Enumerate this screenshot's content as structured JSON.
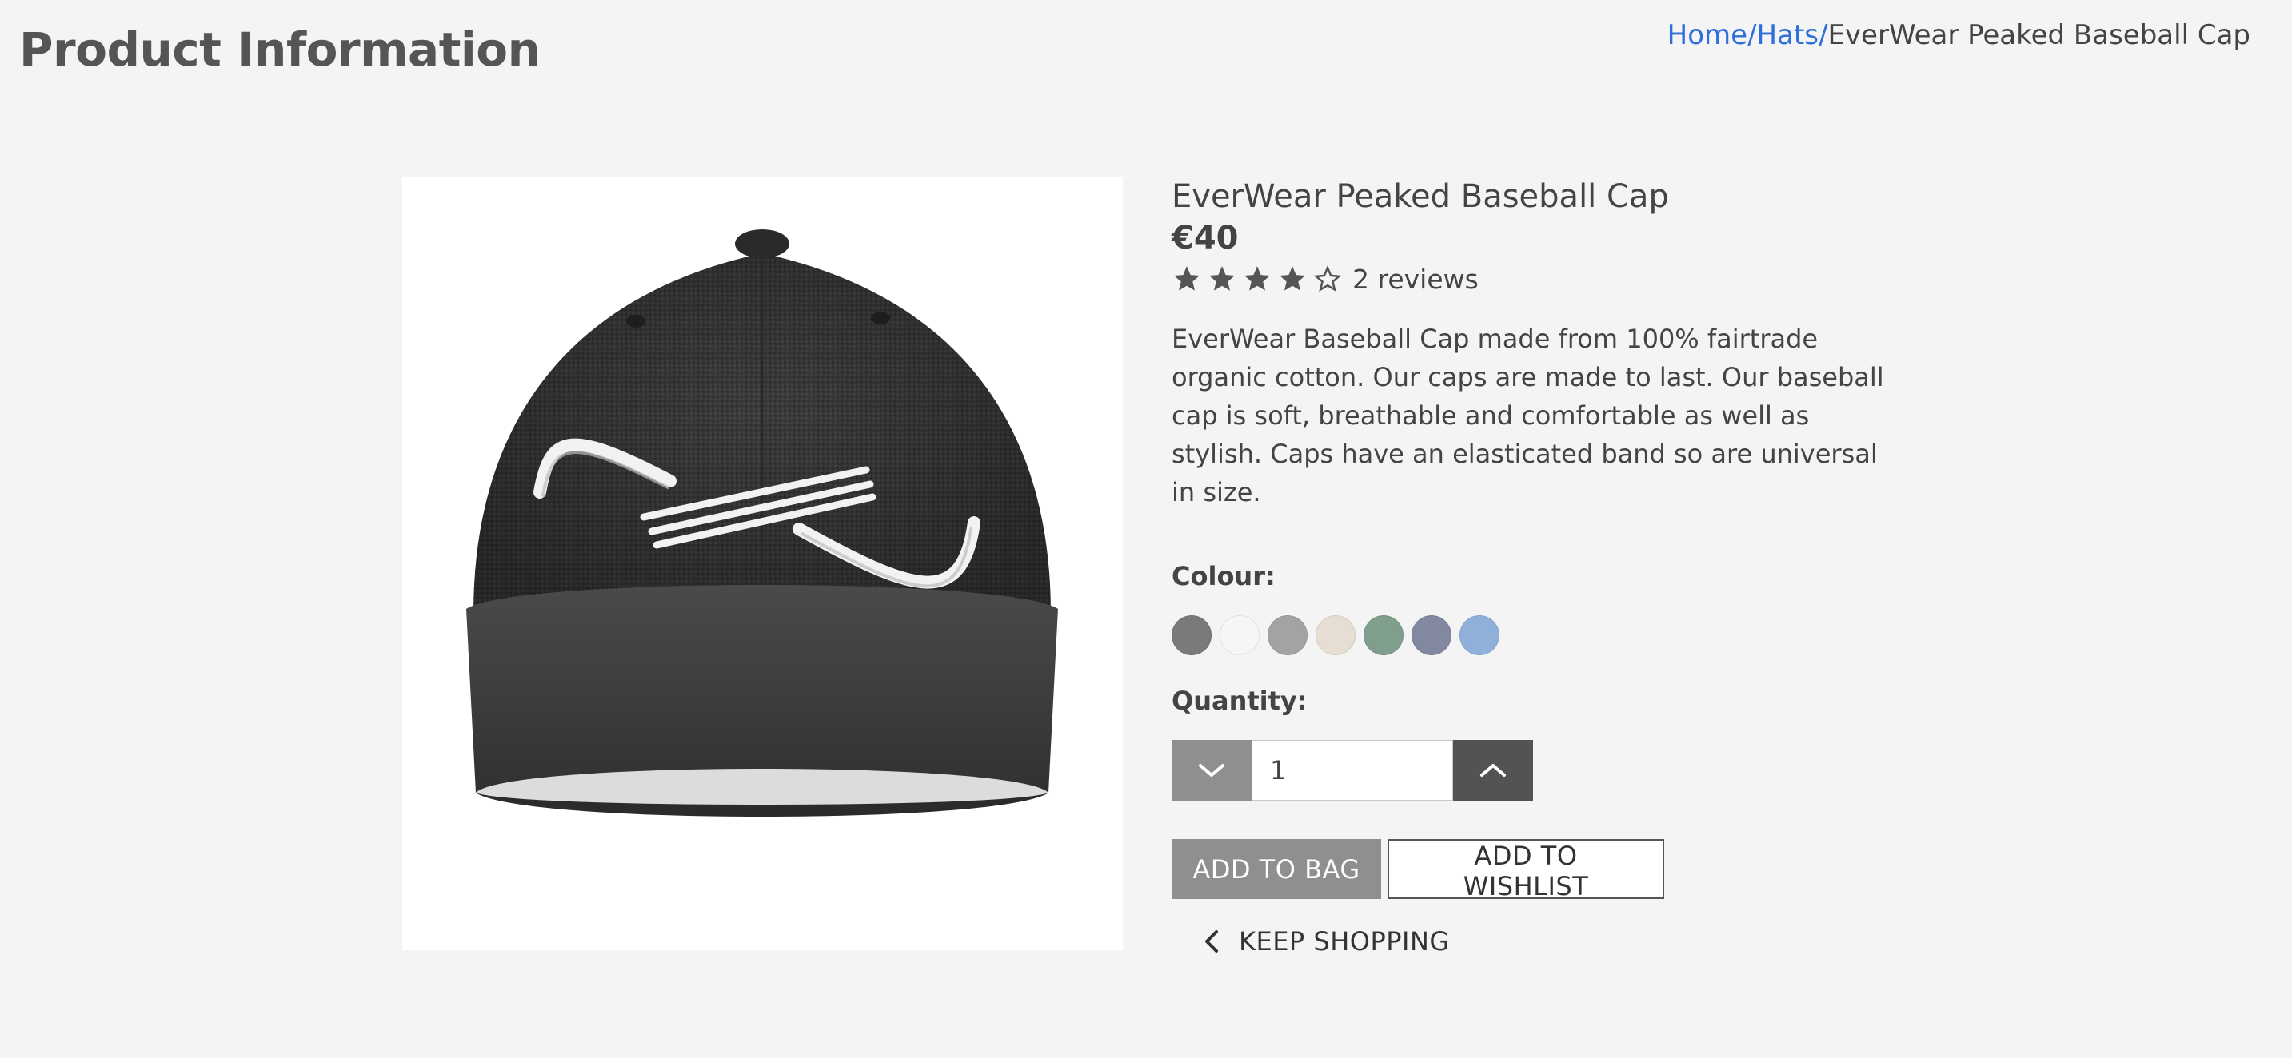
{
  "header": {
    "title": "Product Information"
  },
  "breadcrumb": {
    "items": [
      {
        "label": "Home",
        "link": true
      },
      {
        "label": "Hats",
        "link": true
      },
      {
        "label": "EverWear Peaked Baseball Cap",
        "link": false
      }
    ],
    "separator": "/",
    "link_color": "#2f6fdc"
  },
  "product": {
    "image_icon": "baseball-cap-image",
    "name": "EverWear Peaked Baseball Cap",
    "price": "€40",
    "rating": 4,
    "rating_max": 5,
    "reviews_label": "2 reviews",
    "description": "EverWear Baseball Cap made from 100% fairtrade organic cotton. Our caps are made to last. Our baseball cap is soft, breathable and comfortable as well as stylish. Caps have an elasticated band so are universal in size."
  },
  "colour": {
    "label": "Colour:",
    "swatches": [
      "#7a7a7a",
      "#f6f6f6",
      "#a3a3a3",
      "#e6ded2",
      "#7f9f8c",
      "#8288a0",
      "#8fb0d8"
    ]
  },
  "quantity": {
    "label": "Quantity:",
    "value": "1",
    "decrement_icon": "chevron-down-icon",
    "increment_icon": "chevron-up-icon"
  },
  "actions": {
    "add_to_bag": "ADD TO BAG",
    "add_to_wishlist": "ADD TO WISHLIST",
    "keep_shopping": "KEEP SHOPPING",
    "keep_shopping_icon": "chevron-left-icon"
  },
  "colors": {
    "background": "#f4f4f4",
    "text": "#444444",
    "button_grey": "#8f8f8f",
    "button_dark": "#535353"
  }
}
